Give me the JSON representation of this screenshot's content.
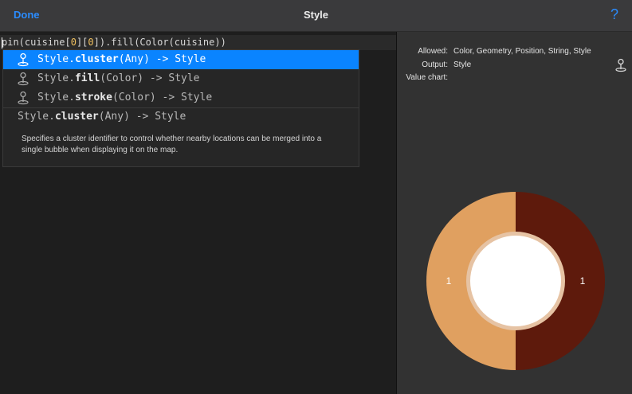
{
  "nav": {
    "done": "Done",
    "title": "Style",
    "help": "?"
  },
  "editor": {
    "code_prefix": "pin(cuisine[",
    "idx1": "0",
    "mid1": "][",
    "idx2": "0",
    "code_suffix": "]).fill(Color(cuisine))"
  },
  "autocomplete": {
    "items": [
      {
        "prefix": "Style.",
        "fn": "cluster",
        "rest": "(Any) -> Style",
        "selected": true
      },
      {
        "prefix": "Style.",
        "fn": "fill",
        "rest": "(Color) -> Style",
        "selected": false
      },
      {
        "prefix": "Style.",
        "fn": "stroke",
        "rest": "(Color) -> Style",
        "selected": false
      }
    ],
    "detail": {
      "prefix": "Style.",
      "fn": "cluster",
      "rest": "(Any) -> Style",
      "description": "Specifies a cluster identifier to control whether nearby locations can be merged into a single bubble when displaying it on the map."
    }
  },
  "info": {
    "allowed_label": "Allowed:",
    "allowed_value": "Color, Geometry, Position, String, Style",
    "output_label": "Output:",
    "output_value": "Style",
    "value_chart_label": "Value chart:"
  },
  "chart_data": {
    "type": "pie",
    "categories": [
      "",
      ""
    ],
    "values": [
      1,
      1
    ],
    "colors": [
      "#e0a060",
      "#5e1a0c"
    ],
    "labels": [
      "1",
      "1"
    ],
    "title": ""
  },
  "icons": {
    "pin": "map-pin-icon",
    "pin_color_selected": "#ffffff",
    "pin_color": "#aaaaaa"
  },
  "colors": {
    "accent": "#2a8cff",
    "selection": "#0a84ff"
  }
}
